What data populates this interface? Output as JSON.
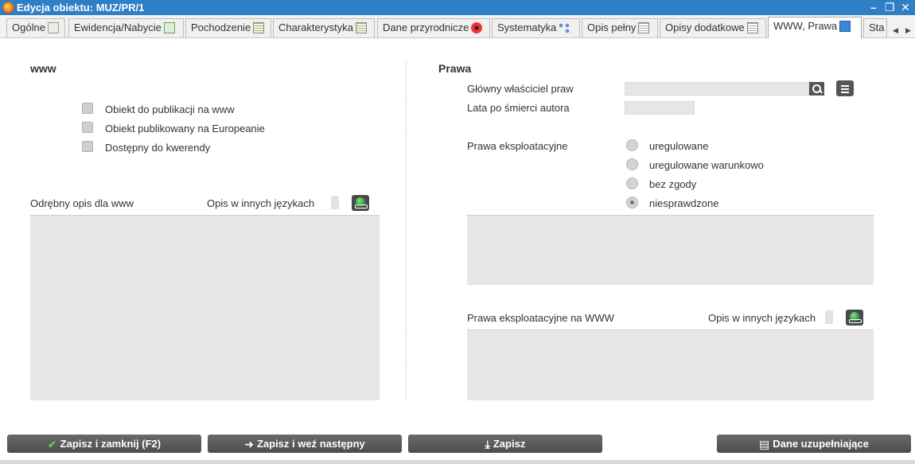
{
  "window": {
    "title": "Edycja obiektu: MUZ/PR/1"
  },
  "tabs": [
    {
      "label": "Ogólne",
      "icon": "table-icon"
    },
    {
      "label": "Ewidencja/Nabycie",
      "icon": "download-icon"
    },
    {
      "label": "Pochodzenie",
      "icon": "grid-icon"
    },
    {
      "label": "Charakterystyka",
      "icon": "grid-icon"
    },
    {
      "label": "Dane przyrodnicze",
      "icon": "poppy-icon"
    },
    {
      "label": "Systematyka",
      "icon": "nodes-icon"
    },
    {
      "label": "Opis pełny",
      "icon": "document-icon"
    },
    {
      "label": "Opisy dodatkowe",
      "icon": "document-icon"
    },
    {
      "label": "WWW, Prawa",
      "icon": "web-icon",
      "active": true
    },
    {
      "label": "Sta",
      "icon": ""
    }
  ],
  "www": {
    "title": "www",
    "checkboxes": [
      {
        "label": "Obiekt do publikacji na www",
        "checked": false
      },
      {
        "label": "Obiekt publikowany na Europeanie",
        "checked": false
      },
      {
        "label": "Dostępny do kwerendy",
        "checked": false
      }
    ],
    "desc_label": "Odrębny opis dla www",
    "other_lang_label": "Opis w innych językach"
  },
  "prawa": {
    "title": "Prawa",
    "owner_label": "Główny właściciel praw",
    "years_label": "Lata po śmierci autora",
    "exploitation_label": "Prawa eksploatacyjne",
    "radios": [
      {
        "label": "uregulowane",
        "checked": false
      },
      {
        "label": "uregulowane warunkowo",
        "checked": false
      },
      {
        "label": "bez zgody",
        "checked": false
      },
      {
        "label": "niesprawdzone",
        "checked": true
      }
    ],
    "www_label": "Prawa eksploatacyjne na WWW",
    "other_lang_label": "Opis w innych językach"
  },
  "footer": {
    "save_close": "Zapisz i zamknij (F2)",
    "save_next": "Zapisz i weź następny",
    "save": "Zapisz",
    "extra": "Dane uzupełniające"
  },
  "colors": {
    "titlebar": "#2f7fc7",
    "button": "#555555",
    "field": "#e6e6e6"
  }
}
